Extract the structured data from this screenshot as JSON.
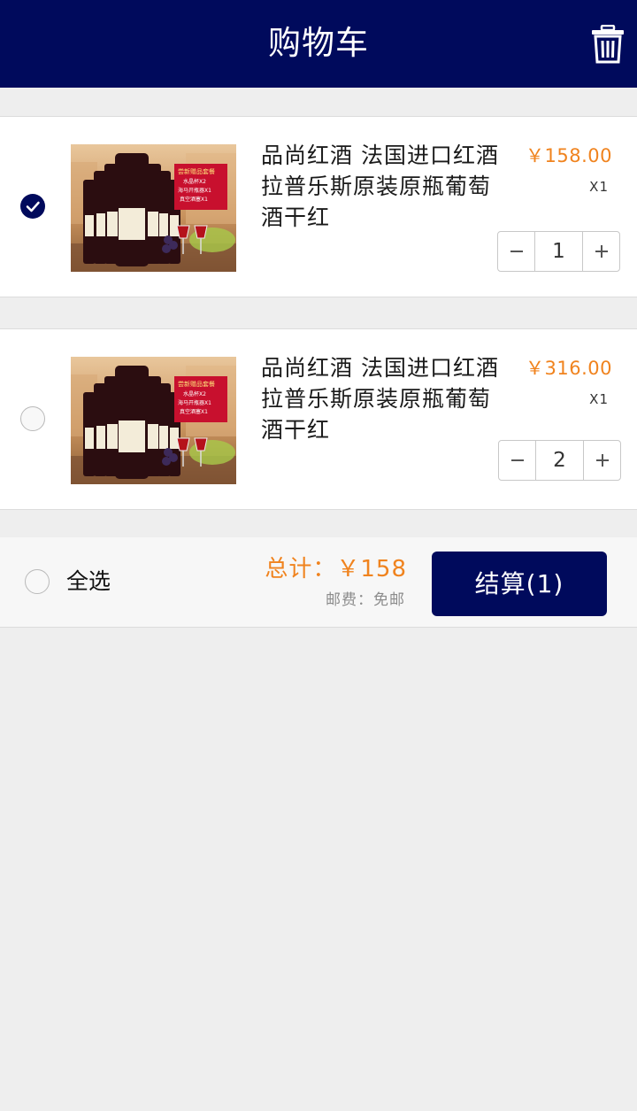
{
  "header": {
    "title": "购物车",
    "trash_icon": "trash-icon"
  },
  "cart": {
    "items": [
      {
        "name": "品尚红酒 法国进口红酒拉普乐斯原装原瓶葡萄酒干红",
        "price": "￥158.00",
        "qty_label": "X1",
        "quantity": "1",
        "selected": true,
        "image_banner": [
          "尝新赠品套餐",
          "水晶杯X2",
          "海马开瓶器X1",
          "真空酒塞X1"
        ]
      },
      {
        "name": "品尚红酒 法国进口红酒拉普乐斯原装原瓶葡萄酒干红",
        "price": "￥316.00",
        "qty_label": "X1",
        "quantity": "2",
        "selected": false,
        "image_banner": [
          "尝新赠品套餐",
          "水晶杯X2",
          "海马开瓶器X1",
          "真空酒塞X1"
        ]
      }
    ]
  },
  "footer": {
    "select_all": "全选",
    "total": "总计：￥158",
    "shipping": "邮费：免邮",
    "checkout": "结算(1)"
  },
  "colors": {
    "brand": "#000a5c",
    "price": "#f0831e"
  }
}
